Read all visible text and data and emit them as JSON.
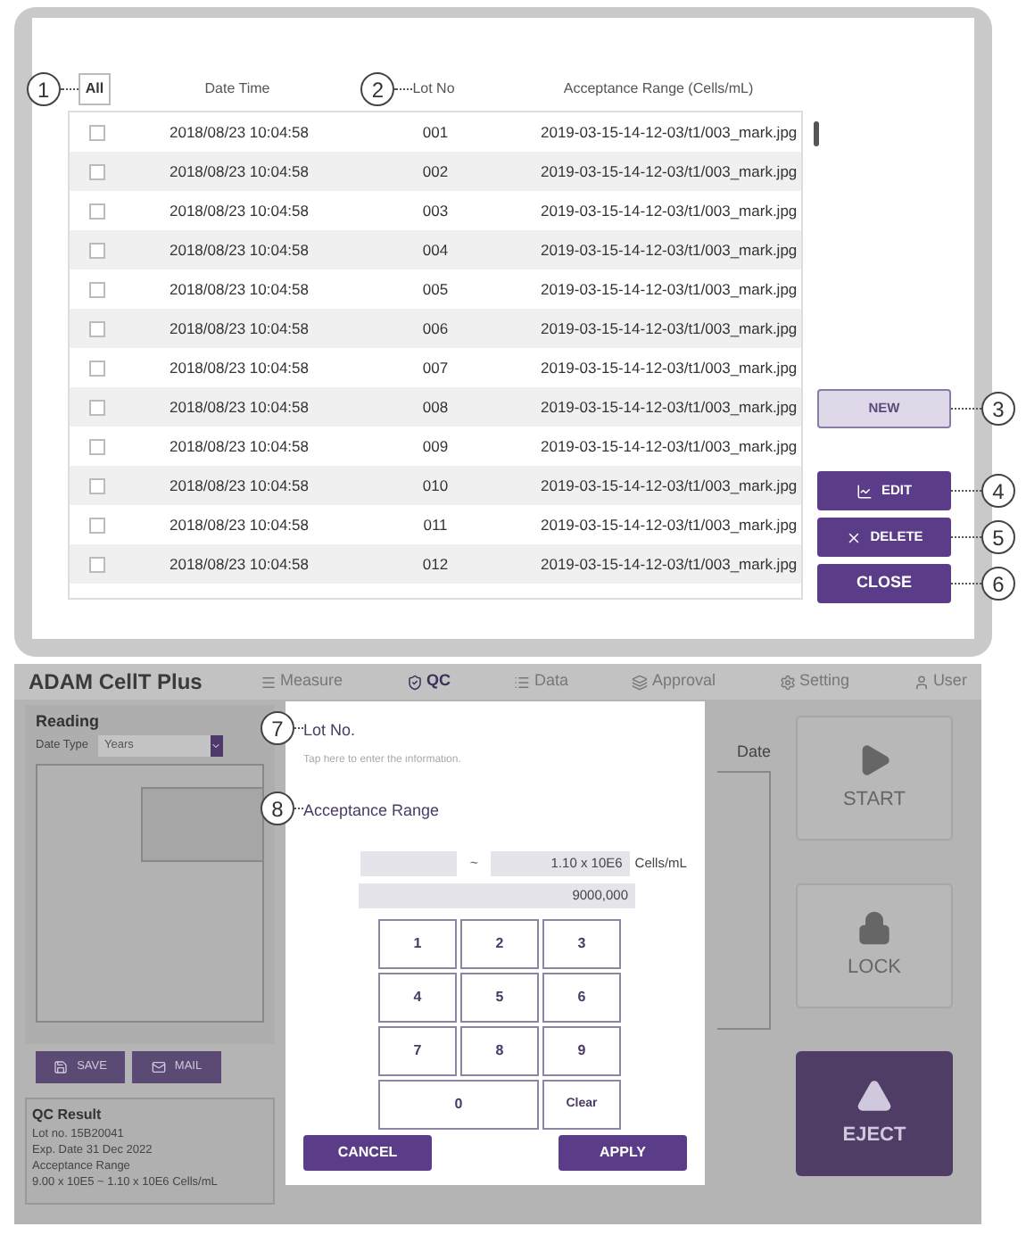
{
  "record_list": {
    "header": {
      "select_all": {
        "label": "All",
        "callout": "1"
      },
      "columns": [
        {
          "label": "Date Time"
        },
        {
          "label": "Lot No",
          "callout": "2"
        },
        {
          "label": "Acceptance Range (Cells/mL)"
        }
      ]
    },
    "rows": [
      {
        "checked": false,
        "date_time": "2018/08/23 10:04:58",
        "lot_no": "001",
        "range": "2019-03-15-14-12-03/t1/003_mark.jpg"
      },
      {
        "checked": false,
        "date_time": "2018/08/23 10:04:58",
        "lot_no": "002",
        "range": "2019-03-15-14-12-03/t1/003_mark.jpg"
      },
      {
        "checked": false,
        "date_time": "2018/08/23 10:04:58",
        "lot_no": "003",
        "range": "2019-03-15-14-12-03/t1/003_mark.jpg"
      },
      {
        "checked": false,
        "date_time": "2018/08/23 10:04:58",
        "lot_no": "004",
        "range": "2019-03-15-14-12-03/t1/003_mark.jpg"
      },
      {
        "checked": false,
        "date_time": "2018/08/23 10:04:58",
        "lot_no": "005",
        "range": "2019-03-15-14-12-03/t1/003_mark.jpg"
      },
      {
        "checked": false,
        "date_time": "2018/08/23 10:04:58",
        "lot_no": "006",
        "range": "2019-03-15-14-12-03/t1/003_mark.jpg"
      },
      {
        "checked": false,
        "date_time": "2018/08/23 10:04:58",
        "lot_no": "007",
        "range": "2019-03-15-14-12-03/t1/003_mark.jpg"
      },
      {
        "checked": false,
        "date_time": "2018/08/23 10:04:58",
        "lot_no": "008",
        "range": "2019-03-15-14-12-03/t1/003_mark.jpg"
      },
      {
        "checked": false,
        "date_time": "2018/08/23 10:04:58",
        "lot_no": "009",
        "range": "2019-03-15-14-12-03/t1/003_mark.jpg"
      },
      {
        "checked": false,
        "date_time": "2018/08/23 10:04:58",
        "lot_no": "010",
        "range": "2019-03-15-14-12-03/t1/003_mark.jpg"
      },
      {
        "checked": false,
        "date_time": "2018/08/23 10:04:58",
        "lot_no": "011",
        "range": "2019-03-15-14-12-03/t1/003_mark.jpg"
      },
      {
        "checked": false,
        "date_time": "2018/08/23 10:04:58",
        "lot_no": "012",
        "range": "2019-03-15-14-12-03/t1/003_mark.jpg"
      }
    ],
    "buttons": [
      {
        "label": "NEW",
        "kind": "outline",
        "callout": "3"
      },
      {
        "label": "EDIT",
        "kind": "edit",
        "callout": "4"
      },
      {
        "label": "DELETE",
        "kind": "delete",
        "callout": "5"
      },
      {
        "label": "CLOSE",
        "kind": "plain",
        "callout": "6"
      }
    ]
  },
  "app": {
    "title": "ADAM CellT Plus",
    "nav": [
      {
        "label": "Measure",
        "selected": false
      },
      {
        "label": "QC",
        "selected": true
      },
      {
        "label": "Data",
        "selected": false
      },
      {
        "label": "Approval",
        "selected": false
      },
      {
        "label": "Setting",
        "selected": false
      },
      {
        "label": "User",
        "selected": false
      }
    ],
    "reading": {
      "title": "Reading",
      "date_type_label": "Date Type",
      "date_type_value": "Years"
    },
    "chart_buttons": [
      {
        "label": "SAVE"
      },
      {
        "label": "MAIL"
      }
    ],
    "qc_result": {
      "title": "QC Result",
      "lines": [
        "Lot no. 15B20041",
        "Exp. Date 31 Dec 2022",
        "Acceptance Range",
        "9.00 x 10E5 ~ 1.10 x 10E6 Cells/mL"
      ]
    },
    "date_label": "Date",
    "side_buttons": [
      {
        "label": "START",
        "kind": "start",
        "disabled": true
      },
      {
        "label": "LOCK",
        "kind": "lock",
        "disabled": true
      },
      {
        "label": "EJECT",
        "kind": "eject",
        "disabled": false
      }
    ]
  },
  "dialog": {
    "lot_no": {
      "label": "Lot No.",
      "callout": "7",
      "placeholder": "Tap here to enter the information."
    },
    "acceptance_range": {
      "label": "Acceptance Range",
      "callout": "8",
      "separator": "~",
      "max": "1.10 x 10E6",
      "unit": "Cells/mL",
      "entry": "9000,000"
    },
    "keys": [
      {
        "label": "1",
        "kind": "digit"
      },
      {
        "label": "2",
        "kind": "digit"
      },
      {
        "label": "3",
        "kind": "digit"
      },
      {
        "label": "4",
        "kind": "digit"
      },
      {
        "label": "5",
        "kind": "digit"
      },
      {
        "label": "6",
        "kind": "digit"
      },
      {
        "label": "7",
        "kind": "digit"
      },
      {
        "label": "8",
        "kind": "digit"
      },
      {
        "label": "9",
        "kind": "digit"
      },
      {
        "label": "0",
        "kind": "wide"
      },
      {
        "label": "Clear",
        "kind": "clear"
      }
    ],
    "buttons": [
      {
        "label": "CANCEL"
      },
      {
        "label": "APPLY"
      }
    ]
  }
}
